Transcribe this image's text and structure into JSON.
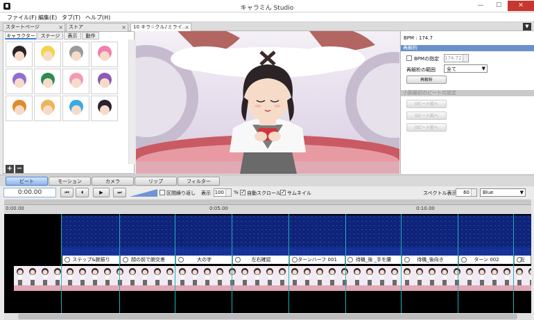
{
  "window": {
    "title": "キャラミん Studio",
    "minimize": "—",
    "maximize": "☐",
    "close": "✕"
  },
  "menu": [
    {
      "label": "ファイル(F)"
    },
    {
      "label": "編集(E)"
    },
    {
      "label": "タブ(T)"
    },
    {
      "label": "ヘルプ(H)"
    }
  ],
  "panel_tabs": {
    "start_page": "スタートページ",
    "store": "ストア",
    "document": "10 キラ☆クル♪ミライ…",
    "close": "×",
    "dropdown": "▼"
  },
  "left_panel": {
    "subtabs": [
      "キャラクター",
      "ステージ",
      "表示",
      "動作"
    ],
    "add": "+",
    "remove": "−",
    "characters": [
      {
        "hair": "#2b2326"
      },
      {
        "hair": "#f3d44a"
      },
      {
        "hair": "#9a9a9a"
      },
      {
        "hair": "#f07fae"
      },
      {
        "hair": "#8d6fd6"
      },
      {
        "hair": "#2f8a55"
      },
      {
        "hair": "#f19ab8"
      },
      {
        "hair": "#8b5ab7"
      },
      {
        "hair": "#e08a2e"
      },
      {
        "hair": "#f0b25a"
      },
      {
        "hair": "#3aa9e3"
      },
      {
        "hair": "#2a2230"
      }
    ]
  },
  "right_panel": {
    "bpm_label": "BPM : 174.7",
    "reanalysis_header": "再解析",
    "bpm_spec_label": "BPMの指定",
    "bpm_value": "174.72",
    "range_label": "再解析の範囲",
    "range_value": "全て",
    "reanalyze_button": "再解析",
    "beat_header": "小節最初のビートの設定",
    "beat_buttons": [
      "0ビート前へ",
      "0ビート前へ",
      "0ビート前へ"
    ]
  },
  "mode_tabs": [
    "ビート",
    "モーション",
    "カメラ",
    "リップ",
    "フィルター"
  ],
  "transport": {
    "time": "0:00.00",
    "buttons": [
      "⏮",
      "⏴",
      "▶",
      "⏭"
    ],
    "loop_label": "区間繰り返し",
    "display_label": "表示",
    "zoom_value": "100",
    "zoom_unit": "%",
    "autoscroll_label": "自動スクロール",
    "thumbnail_label": "サムネイル",
    "spectrum_label": "スペクトル表示",
    "spectrum_value": "60",
    "color_value": "Blue"
  },
  "ruler": [
    "0:00.00",
    "0:05.00",
    "0:10.00"
  ],
  "clips": [
    "ステップ&腕振り",
    "顔の前で腕交差",
    "大の字",
    "左右確認",
    "ターンハーフ 001",
    "待機_後  _手を腰",
    "待機_後向き",
    "ターン 002",
    "左"
  ],
  "colors": {
    "accent": "#6a91c9",
    "spectrogram": "#0d1e6b",
    "marker": "#1fb3b3"
  }
}
